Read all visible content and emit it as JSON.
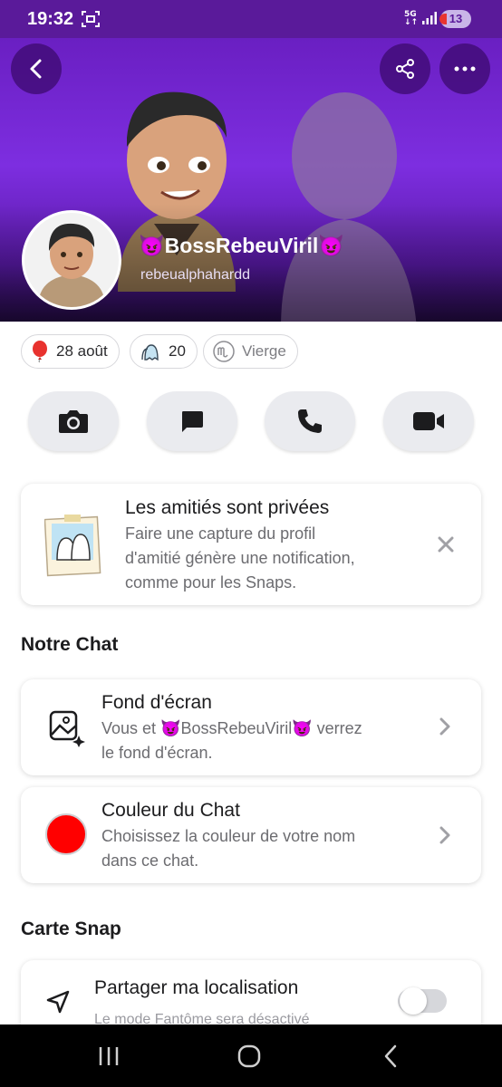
{
  "status_bar": {
    "time": "19:32",
    "network": "5G",
    "battery": "13"
  },
  "profile": {
    "display_name": "😈BossRebeuViril😈",
    "username": "rebeualphahardd"
  },
  "chips": {
    "birthday": "28 août",
    "snapscore": "20",
    "zodiac": "Vierge"
  },
  "actions": [
    "camera-icon",
    "chat-icon",
    "phone-icon",
    "video-icon"
  ],
  "friendship_card": {
    "title": "Les amitiés sont privées",
    "line1": "Faire une capture du profil",
    "line2": "d'amitié génère une notification,",
    "line3": "comme pour les Snaps."
  },
  "sections": {
    "chat": "Notre Chat",
    "map": "Carte Snap"
  },
  "wallpaper_card": {
    "title": "Fond d'écran",
    "line1": "Vous et 😈BossRebeuViril😈 verrez",
    "line2": "le fond d'écran."
  },
  "chat_color_card": {
    "title": "Couleur du Chat",
    "line1": "Choisissez la couleur de votre nom",
    "line2": "dans ce chat.",
    "color": "#ff0000"
  },
  "location_card": {
    "title": "Partager ma localisation",
    "subtitle": "Le mode Fantôme sera désactivé",
    "toggle_on": false
  },
  "colors": {
    "hero_purple": "#7d2ee0",
    "status_bar": "#5a1a9a",
    "card_bg": "#ffffff",
    "action_bg": "#eaebef"
  }
}
